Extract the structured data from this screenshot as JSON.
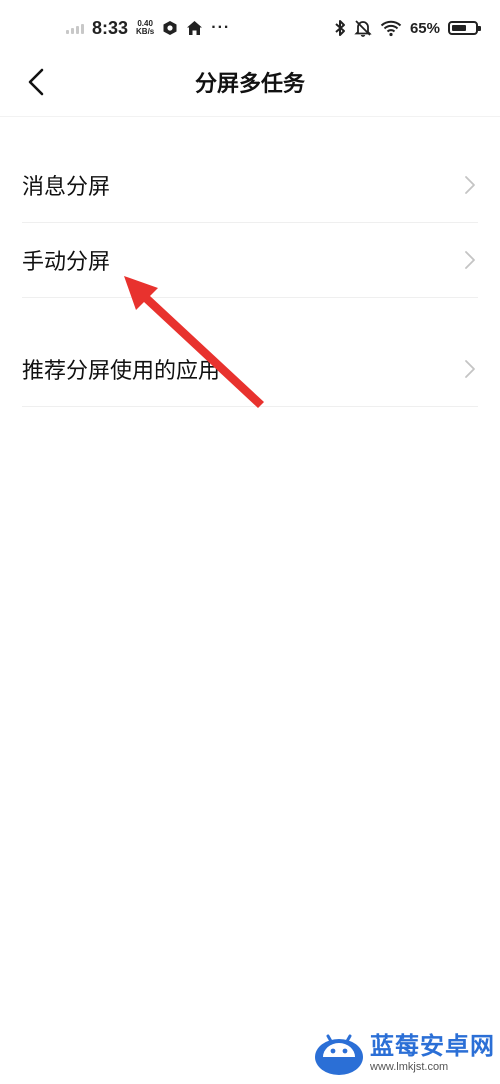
{
  "status_bar": {
    "time": "8:33",
    "net_speed_value": "0.40",
    "net_speed_unit": "KB/s",
    "more": "···",
    "battery_percent": "65%",
    "battery_level": 0.65,
    "icons": [
      "signal-icon",
      "hexagon-app-icon",
      "home-icon",
      "bluetooth-icon",
      "mute-bell-icon",
      "wifi-icon",
      "battery-icon"
    ]
  },
  "header": {
    "title": "分屏多任务",
    "back_icon": "chevron-left-icon"
  },
  "settings": {
    "items": [
      {
        "label": "消息分屏"
      },
      {
        "label": "手动分屏"
      },
      {
        "label": "推荐分屏使用的应用"
      }
    ],
    "chevron_icon": "chevron-right-icon"
  },
  "annotation": {
    "color": "#e8322e"
  },
  "watermark": {
    "brand": "蓝莓安卓网",
    "url": "www.lmkjst.com",
    "brand_color": "#2b6fd6"
  }
}
